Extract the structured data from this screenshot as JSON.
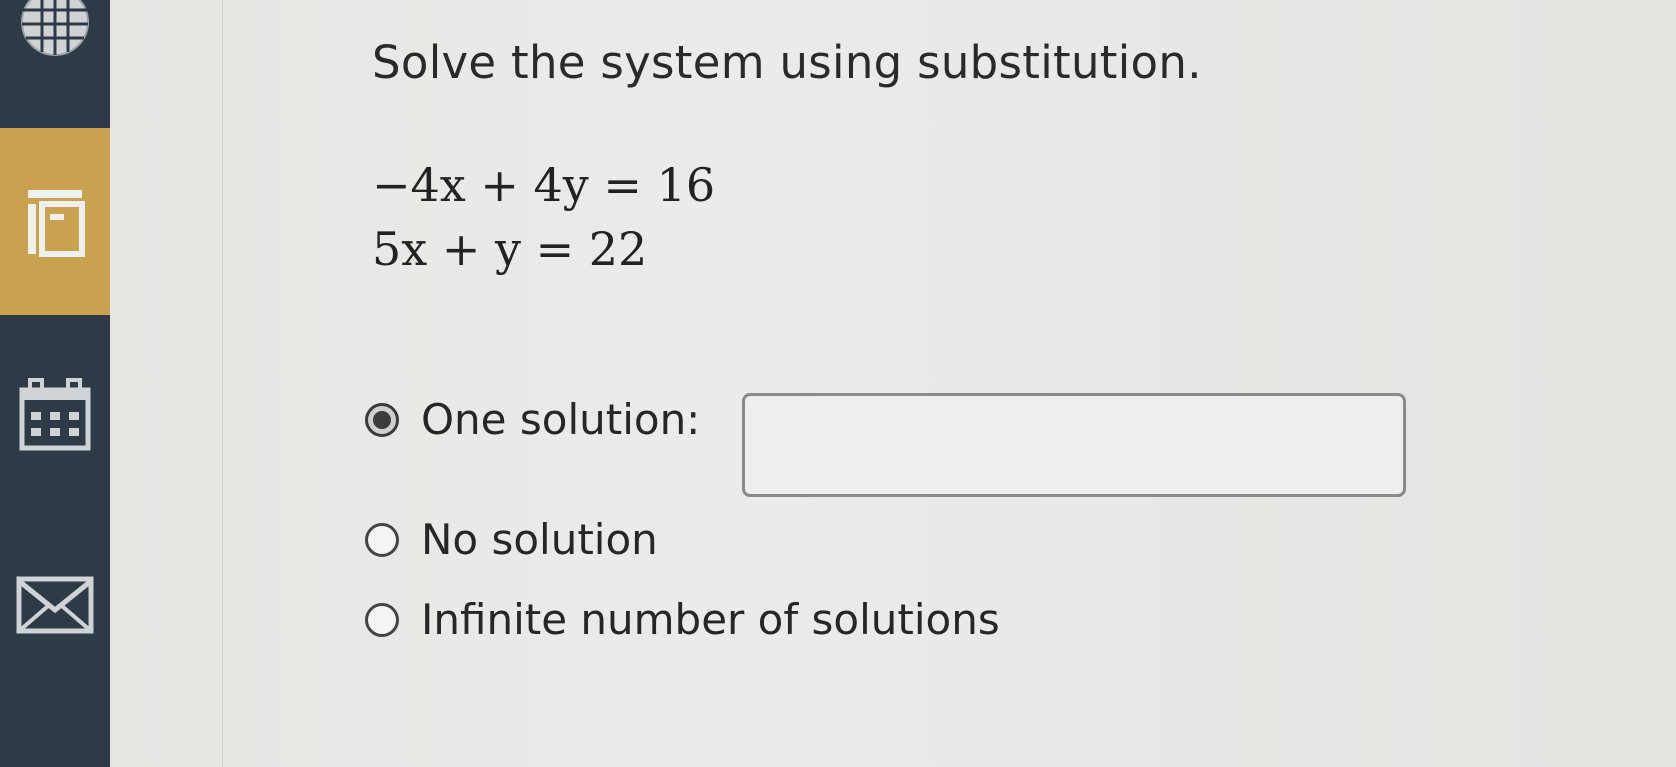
{
  "sidebar": {
    "items": [
      {
        "icon": "globe-icon",
        "active": false
      },
      {
        "icon": "content-icon",
        "active": true
      },
      {
        "icon": "calendar-icon",
        "active": false
      },
      {
        "icon": "mail-icon",
        "active": false
      }
    ],
    "colors": {
      "background": "#2e3a45",
      "active": "#c9a24f"
    }
  },
  "question": {
    "prompt": "Solve the system using substitution.",
    "equations": [
      "−4x + 4y = 16",
      "5x + y = 22"
    ]
  },
  "options": [
    {
      "label": "One solution:",
      "selected": true
    },
    {
      "label": "No solution",
      "selected": false
    },
    {
      "label": "Infinite number of solutions",
      "selected": false
    }
  ],
  "answer": {
    "value": ""
  }
}
